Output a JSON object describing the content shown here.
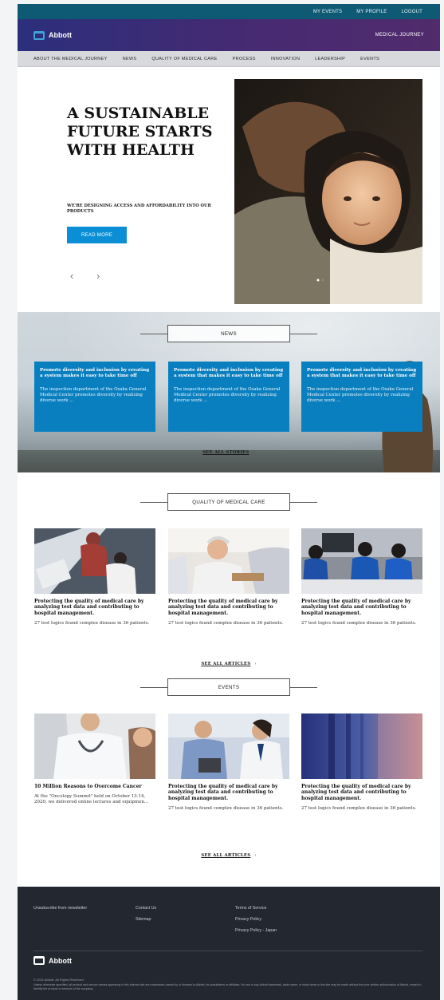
{
  "utility_nav": {
    "my_events": "MY EVENTS",
    "my_profile": "MY PROFILE",
    "logout": "LOGOUT"
  },
  "brand": {
    "logo_text": "Abbott",
    "site_name": "MEDICAL JOURNEY"
  },
  "main_nav": [
    "ABOUT THE MEDICAL JOURNEY",
    "NEWS",
    "QUALITY OF MEDICAL CARE",
    "PROCESS",
    "INNOVATION",
    "LEADERSHIP",
    "EVENTS"
  ],
  "hero": {
    "title": "A SUSTAINABLE FUTURE STARTS WITH HEALTH",
    "subtitle": "WE'RE DESIGNING ACCESS AND AFFORDABILITY INTO OUR PRODUCTS",
    "cta": "READ MORE",
    "prev": "‹",
    "next": "›"
  },
  "news": {
    "heading": "NEWS",
    "cards": [
      {
        "title": "Promote diversity and inclusion by creating a system makes it easy to take time off",
        "desc": "The inspection department of the Osaka General Medical Center promotes diversity by realizing diverse work ..."
      },
      {
        "title": "Promote diversity and inclusion by creating a system that makes it easy to take time off",
        "desc": "The inspection department of the Osaka General Medical Center promotes diversity by realizing diverse work ..."
      },
      {
        "title": "Promote diversity and inclusion by creating a system that makes it easy to take time off",
        "desc": "The inspection department of the Osaka General Medical Center promotes diversity by realizing diverse work ..."
      }
    ],
    "see_all": "SEE ALL STORIES",
    "chevron": "›"
  },
  "quality": {
    "heading": "QUALITY OF MEDICAL CARE",
    "cards": [
      {
        "title": "Protecting the quality of medical care by analyzing test data and contributing to hospital management.",
        "desc": "27 test logics found complex disease in 36 patients."
      },
      {
        "title": "Protecting the quality of medical care by analyzing test data and contributing to hospital management.",
        "desc": "27 test logics found complex disease in 36 patients."
      },
      {
        "title": "Protecting the quality of medical care by analyzing test data and contributing to hospital management.",
        "desc": "27 test logics found complex disease in 36 patients."
      }
    ],
    "see_all": "SEE ALL ARTICLES",
    "chevron": "›"
  },
  "events": {
    "heading": "EVENTS",
    "cards": [
      {
        "title": "10 Million Reasons to Overcome Cancer",
        "desc": "At the \"Oncology Summit\" held on October 13-14, 2020, we delivered online lectures and equipmen..."
      },
      {
        "title": "Protecting the quality of medical care by analyzing test data and contributing to hospital management.",
        "desc": "27 test logics found complex disease in 36 patients."
      },
      {
        "title": "Protecting the quality of medical care by analyzing test data and contributing to hospital management.",
        "desc": "27 test logics found complex disease in 36 patients."
      }
    ],
    "see_all": "SEE ALL ARTICLES",
    "chevron": "›"
  },
  "footer": {
    "unsubscribe": "Unsubscribe from newsletter",
    "contact": "Contact Us",
    "sitemap": "Sitemap",
    "terms": "Terms of Service",
    "privacy": "Privacy Policy",
    "privacy_japan": "Privacy Policy - Japan",
    "logo_text": "Abbott",
    "copyright": "© 2021 Abbott. All Rights Reserved.",
    "legal": "Unless otherwise specified, all product and service names appearing in this Internet site are trademarks owned by or licensed to Abbott, its subsidiaries or affiliates. No use of any Abbott trademark, trade name, or trade dress in this site may be made without the prior written authorization of Abbott, except to identify the product or services of the company."
  },
  "colors": {
    "utility_bar": "#0e5a75",
    "brand_gradient_start": "#2b2f7c",
    "brand_gradient_end": "#512b6c",
    "accent_blue": "#0a8fd6",
    "news_card": "#0a7fbf",
    "footer": "#232730"
  }
}
